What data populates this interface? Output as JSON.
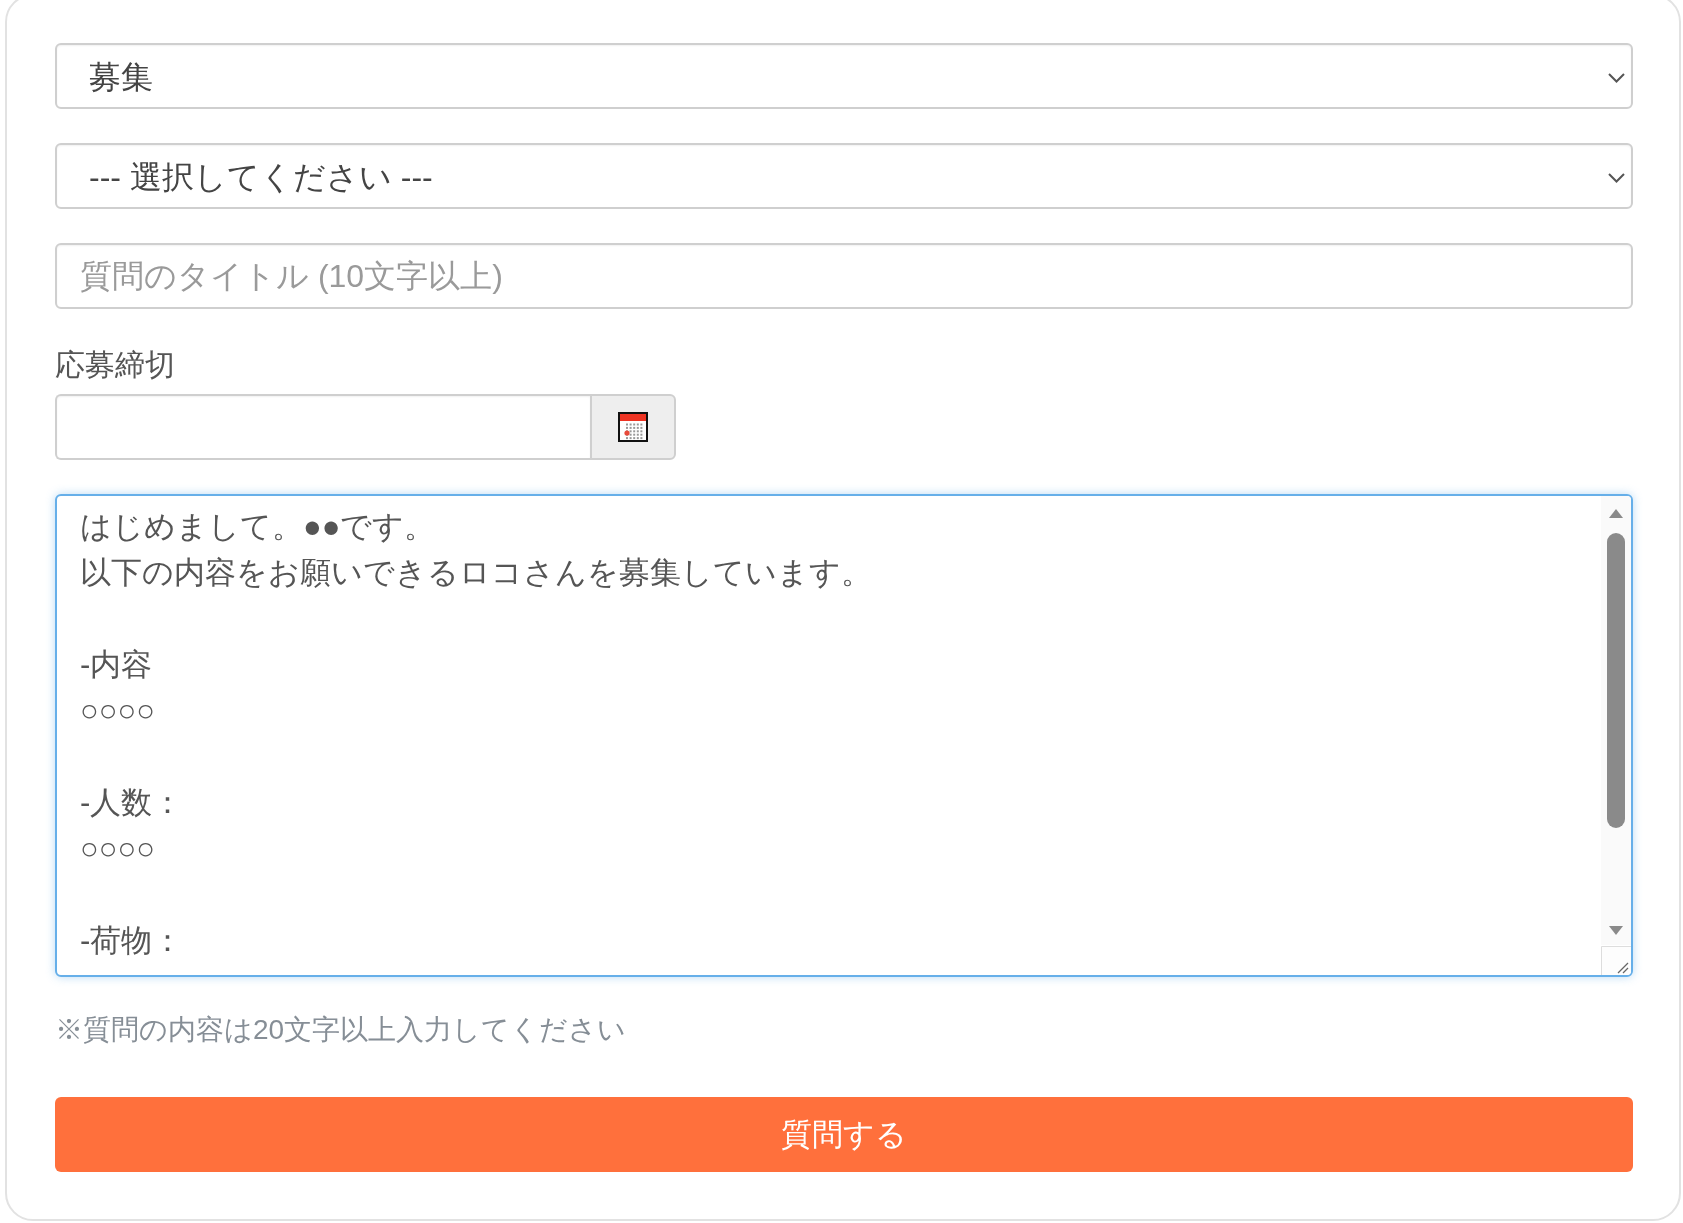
{
  "dropdowns": [
    {
      "value": "募集"
    },
    {
      "value": "--- 選択してください ---"
    }
  ],
  "title_field": {
    "placeholder": "質問のタイトル (10文字以上)"
  },
  "deadline": {
    "label": "応募締切"
  },
  "body_field": {
    "focused": true,
    "paragraphs": [
      [
        "はじめまして。●●です。",
        "以下の内容をお願いできるロコさんを募集しています。"
      ],
      [
        "-内容",
        "○○○○"
      ],
      [
        "-人数：",
        "○○○○"
      ],
      [
        "-荷物："
      ]
    ]
  },
  "hint": "※質問の内容は20文字以上入力してください",
  "submit_button": "質問する"
}
